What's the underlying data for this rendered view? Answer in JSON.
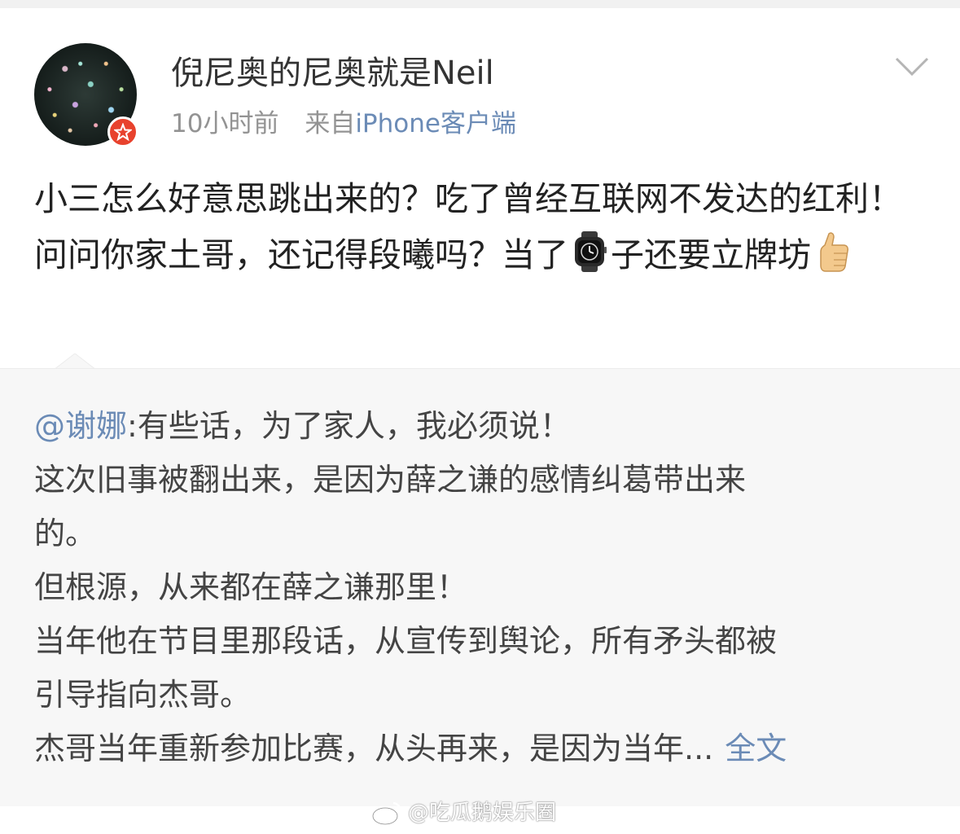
{
  "post": {
    "username": "倪尼奥的尼奥就是Neil",
    "time": "10小时前",
    "source_prefix": "来自",
    "source_client": "iPhone客户端",
    "text_part1": "小三怎么好意思跳出来的？吃了曾经互联网不发达的红利！问问你家土哥，还记得段曦吗？当了",
    "inline_emoji_1": "watch-icon",
    "text_part2": "子还要立牌坊",
    "inline_emoji_2": "thumbs-up-icon"
  },
  "repost": {
    "mention": "@谢娜",
    "lines": [
      ":有些话，为了家人，我必须说！",
      "这次旧事被翻出来，是因为薛之谦的感情纠葛带出来",
      "的。",
      "但根源，从来都在薛之谦那里！",
      "当年他在节目里那段话，从宣传到舆论，所有矛头都被",
      "引导指向杰哥。",
      "杰哥当年重新参加比赛，从头再来，是因为当年..."
    ],
    "full_text_link": "全文"
  },
  "watermark": {
    "text": "@吃瓜鹅娱乐圈"
  },
  "colors": {
    "link": "#6b8bb6",
    "badge": "#e8422d",
    "repost_bg": "#f7f7f7"
  }
}
